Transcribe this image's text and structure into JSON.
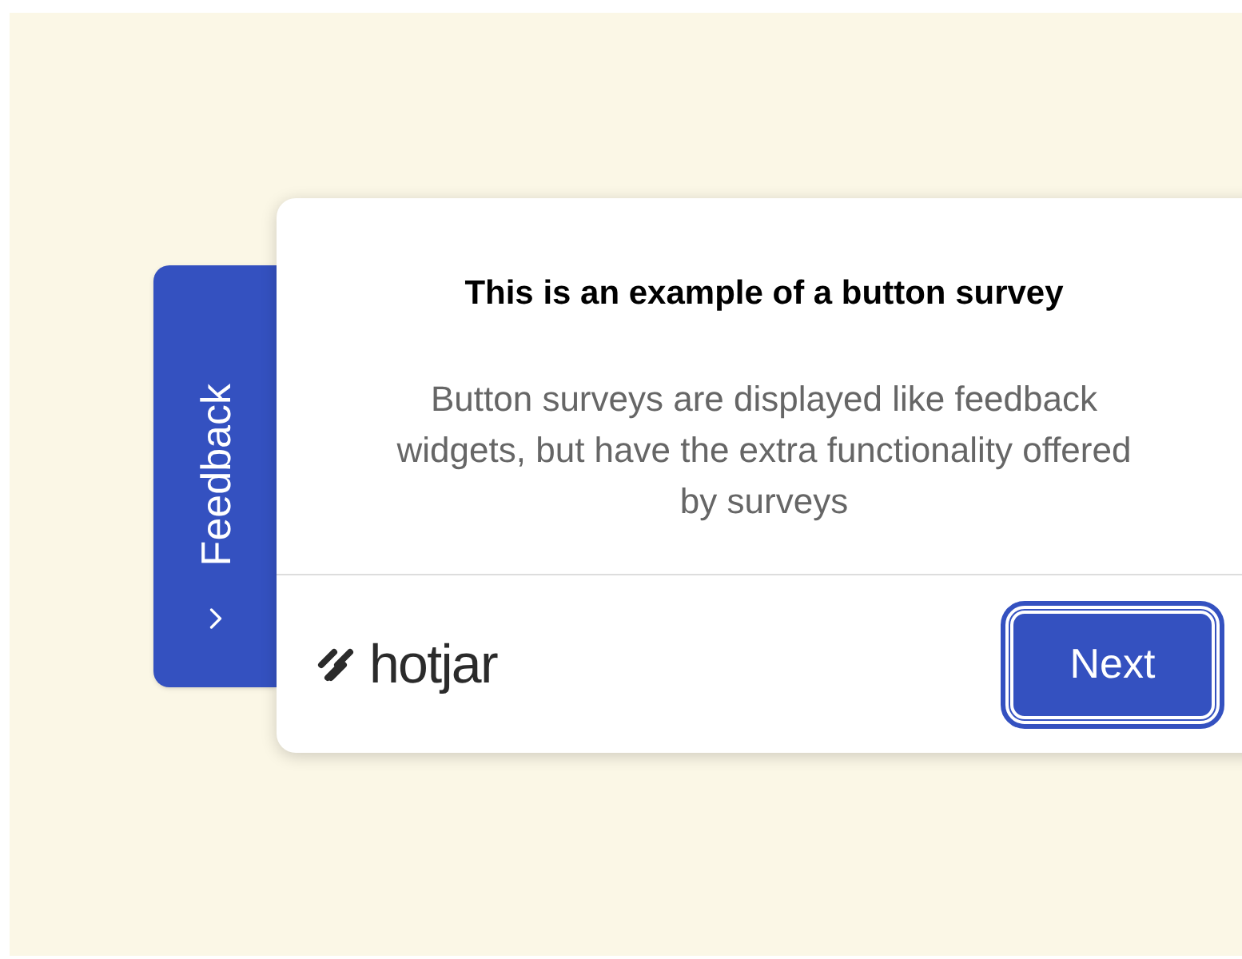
{
  "feedback_tab": {
    "label": "Feedback"
  },
  "survey": {
    "title": "This is an example of a button survey",
    "description": "Button surveys are displayed like feedback widgets, but have the extra functionality offered by surveys",
    "brand": "hotjar",
    "button": "Next"
  }
}
